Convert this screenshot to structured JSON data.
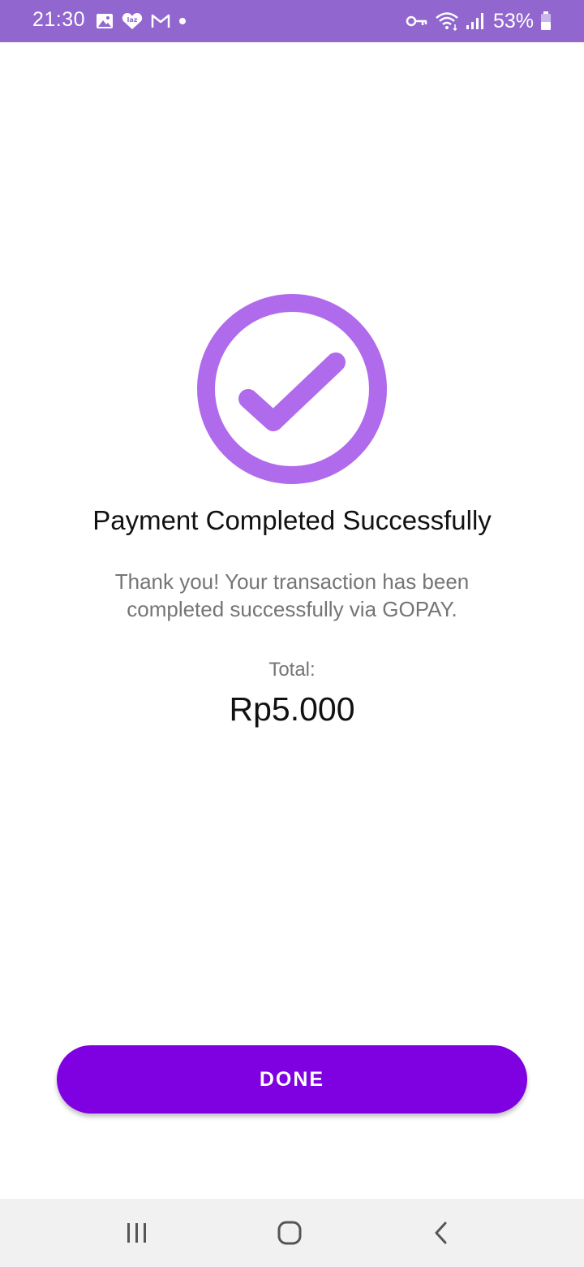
{
  "status_bar": {
    "time": "21:30",
    "battery_percent": "53%",
    "background": "#9166cf",
    "left_icons": [
      "gallery-icon",
      "lazada-icon",
      "gmail-icon",
      "notification-dot-icon"
    ],
    "right_icons": [
      "vpn-key-icon",
      "wifi-icon",
      "signal-icon",
      "battery-icon"
    ]
  },
  "success": {
    "icon": "check-circle-icon",
    "color": "#b06bec",
    "title": "Payment Completed Successfully",
    "message": "Thank you! Your transaction has been completed successfully via GOPAY.",
    "total_label": "Total:",
    "total_amount": "Rp5.000"
  },
  "actions": {
    "done_label": "DONE",
    "done_color": "#7f00e0"
  },
  "nav_bar": {
    "buttons": [
      "recent-apps-icon",
      "home-icon",
      "back-icon"
    ]
  }
}
